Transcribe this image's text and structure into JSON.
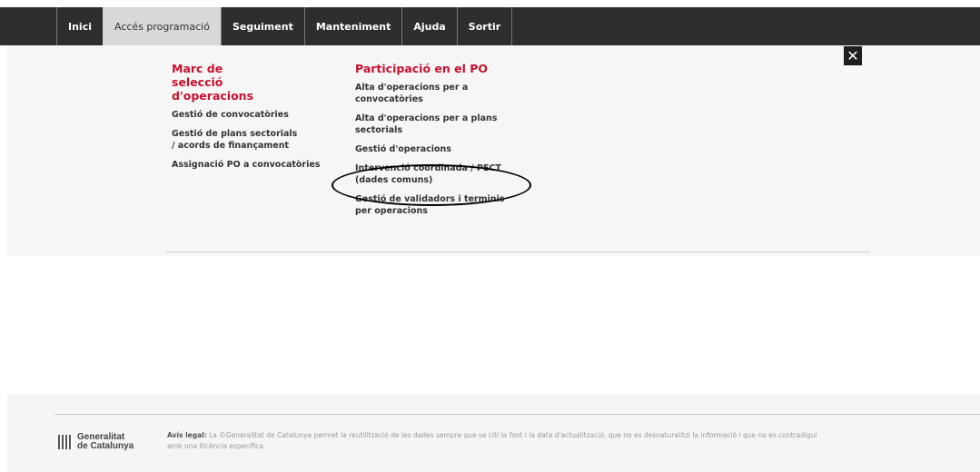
{
  "nav": {
    "items": [
      "Inici",
      "Accés programació",
      "Seguiment",
      "Manteniment",
      "Ajuda",
      "Sortir"
    ]
  },
  "menu": {
    "col1": {
      "title": "Marc de selecció d'operacions",
      "links": [
        "Gestió de convocatòries",
        "Gestió de plans sectorials / acords de finançament",
        "Assignació PO a convocatòries"
      ]
    },
    "col2": {
      "title": "Participació en el PO",
      "links": [
        "Alta d'operacions per a convocatòries",
        "Alta d'operacions per a plans sectorials",
        "Gestió d'operacions",
        "Intervenció coordinada / PECT (dades comuns)",
        "Gestió de validadors i terminis per operacions"
      ]
    },
    "close_label": "✕"
  },
  "footer": {
    "logo_line1": "Generalitat",
    "logo_line2": "de Catalunya",
    "legal_label": "Avís legal:",
    "legal_text": "La ©Generalitat de Catalunya permet la reutilització de les dades sempre que se citi la font i la data d'actualització, que no es desnaturalitzi la informació i que no es contradigui amb una llicència específica."
  },
  "colors": {
    "accent": "#c8102e",
    "topbar": "#2e2e2e"
  }
}
